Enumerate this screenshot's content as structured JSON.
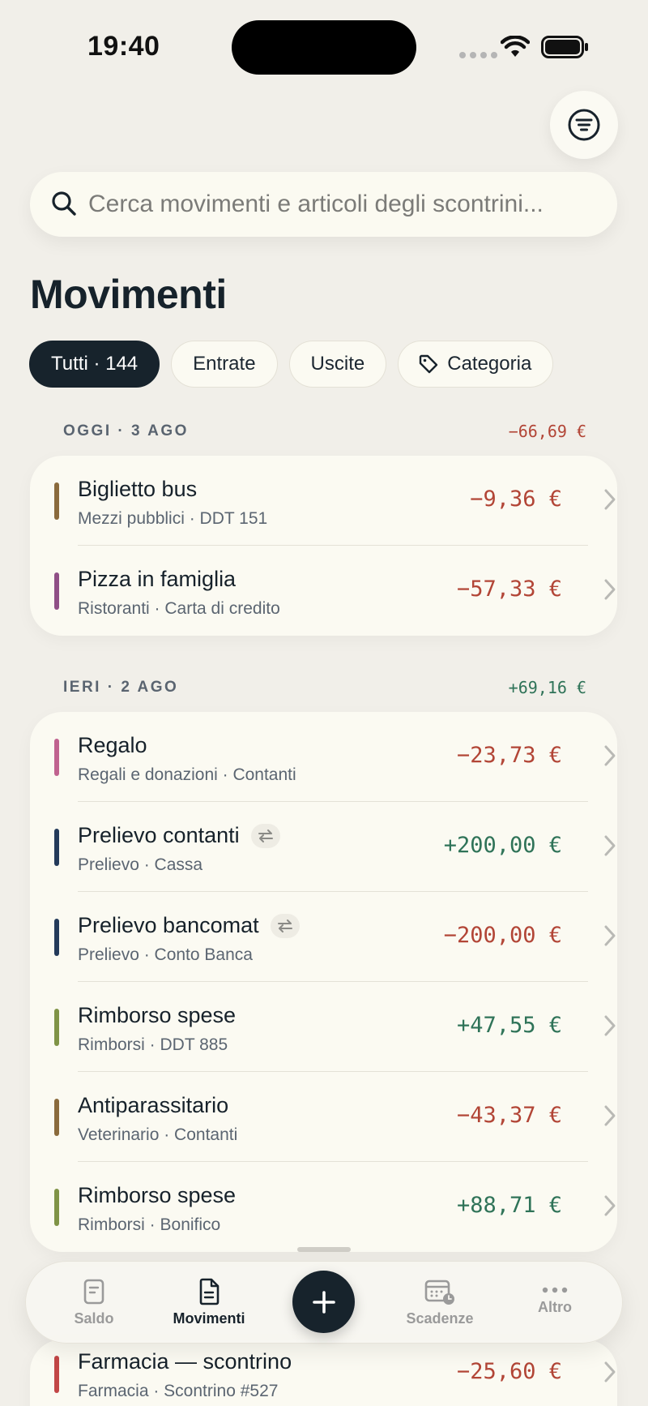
{
  "status_bar": {
    "time": "19:40"
  },
  "search": {
    "placeholder": "Cerca movimenti e articoli degli scontrini..."
  },
  "page": {
    "title": "Movimenti"
  },
  "chips": {
    "all": "Tutti · 144",
    "income": "Entrate",
    "expenses": "Uscite",
    "category": "Categoria"
  },
  "sections": [
    {
      "date": "OGGI · 3 AGO",
      "total": "−66,69 €",
      "rows": [
        {
          "title": "Biglietto bus",
          "subtitle": "Mezzi pubblici · DDT 151",
          "amount": "−9,36 €",
          "color": "#8a6a3c"
        },
        {
          "title": "Pizza in famiglia",
          "subtitle": "Ristoranti · Carta di credito",
          "amount": "−57,33 €",
          "color": "#8f4f86"
        }
      ]
    },
    {
      "date": "IERI · 2 AGO",
      "total": "+69,16 €",
      "rows": [
        {
          "title": "Regalo",
          "subtitle": "Regali e donazioni · Contanti",
          "amount": "−23,73 €",
          "color": "#c0628f"
        },
        {
          "title": "Prelievo contanti",
          "subtitle": "Prelievo · Cassa",
          "amount": "+200,00 €",
          "color": "#233a5a"
        },
        {
          "title": "Prelievo bancomat",
          "subtitle": "Prelievo · Conto Banca",
          "amount": "−200,00 €",
          "color": "#233a5a"
        },
        {
          "title": "Rimborso spese",
          "subtitle": "Rimborsi · DDT 885",
          "amount": "+47,55 €",
          "color": "#7f9346"
        },
        {
          "title": "Antiparassitario",
          "subtitle": "Veterinario · Contanti",
          "amount": "−43,37 €",
          "color": "#8a6a3c"
        },
        {
          "title": "Rimborso spese",
          "subtitle": "Rimborsi · Bonifico",
          "amount": "+88,71 €",
          "color": "#7f9346"
        }
      ]
    },
    {
      "rows": [
        {
          "title": "Farmacia — scontrino",
          "subtitle": "Farmacia · Scontrino #527",
          "amount": "−25,60 €",
          "color": "#c24646"
        }
      ]
    }
  ],
  "tabbar": {
    "saldo": "Saldo",
    "movimenti": "Movimenti",
    "scadenze": "Scadenze",
    "altro": "Altro"
  },
  "colors": {
    "background": "#f1efe9",
    "card": "#fbfaf2",
    "accent_dark": "#17232c",
    "negative": "#b24536",
    "positive": "#2f7358"
  },
  "icons": [
    "filter-icon",
    "search-icon",
    "tag-icon",
    "chevron-right-icon",
    "transfer-icon",
    "receipt-icon",
    "document-icon",
    "plus-icon",
    "calendar-clock-icon",
    "more-icon",
    "wifi-icon",
    "battery-icon"
  ]
}
